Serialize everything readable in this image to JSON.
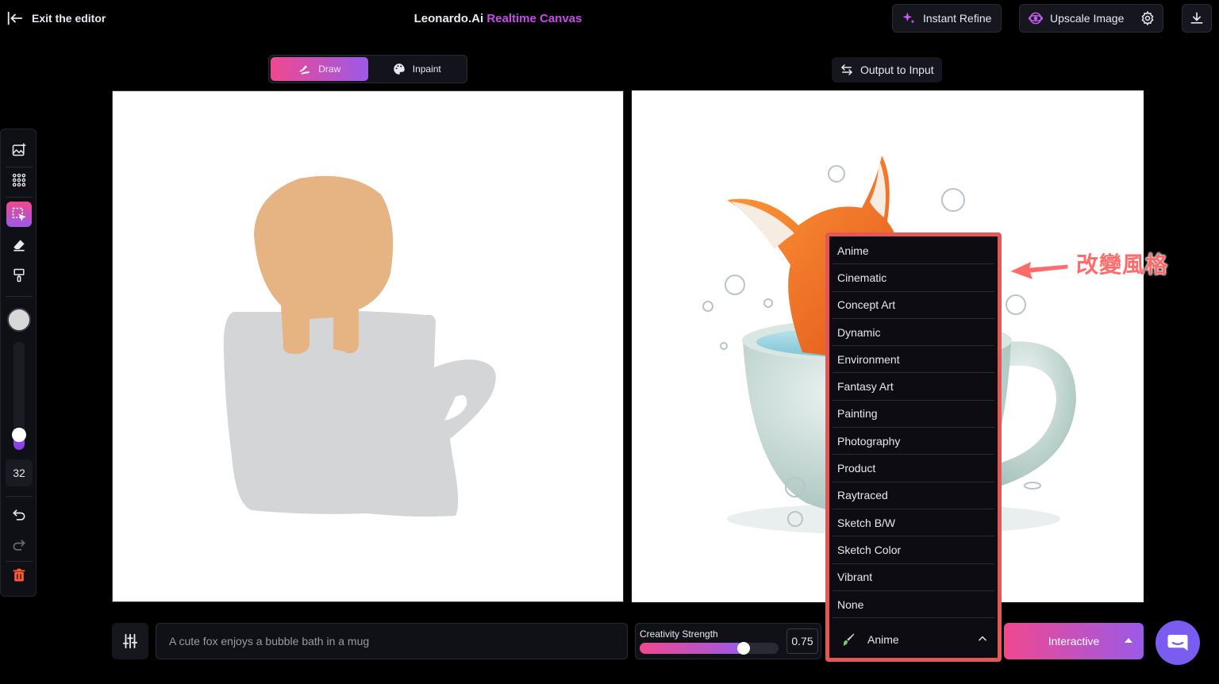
{
  "header": {
    "exit_label": "Exit the editor",
    "title_main": "Leonardo.Ai",
    "title_accent": "Realtime Canvas",
    "instant_refine_label": "Instant Refine",
    "upscale_label": "Upscale Image"
  },
  "modes": {
    "draw_label": "Draw",
    "inpaint_label": "Inpaint"
  },
  "output_to_input_label": "Output to Input",
  "toolbar": {
    "brush_size": "32",
    "brush_level": 0.2
  },
  "style_dropdown": {
    "options": [
      "Anime",
      "Cinematic",
      "Concept Art",
      "Dynamic",
      "Environment",
      "Fantasy Art",
      "Painting",
      "Photography",
      "Product",
      "Raytraced",
      "Sketch B/W",
      "Sketch Color",
      "Vibrant",
      "None"
    ],
    "selected": "Anime"
  },
  "annotation": "改變風格",
  "prompt": {
    "placeholder": "A cute fox enjoys a bubble bath in a mug"
  },
  "creativity": {
    "label": "Creativity Strength",
    "value": "0.75"
  },
  "interactive_label": "Interactive",
  "colors": {
    "accent_pink": "#f0488f",
    "accent_purple": "#9b5ae8",
    "annotation_red": "#e45757",
    "sketch_orange": "#e5b482",
    "sketch_gray": "#d4d5d6"
  }
}
